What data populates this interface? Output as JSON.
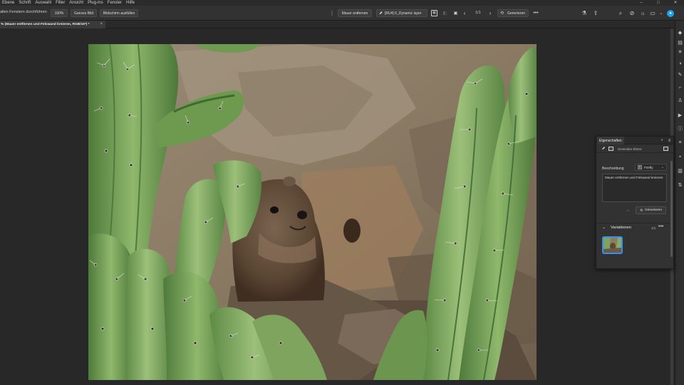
{
  "menu": {
    "items": [
      "Ebene",
      "Schrift",
      "Auswahl",
      "Filter",
      "Ansicht",
      "Plug-ins",
      "Fenster",
      "Hilfe"
    ],
    "window_controls": [
      "–",
      "□",
      "✕"
    ]
  },
  "options_bar": {
    "scroll_all_label": "allen Fenstern durchführen",
    "zoom_value": "100%",
    "fit_screen_label": "Ganzes Bild",
    "fill_screen_label": "Bildschirm ausfüllen",
    "remove_wall_label": "Mauer entfernen",
    "layer_name": "[RU4] 6_Dynamic layer",
    "page_counter": "1/1",
    "generate_label": "Generieren"
  },
  "document": {
    "tab_title": "% (Mauer entfernen und Felswand kreieren, RGB/16*) *",
    "close_glyph": "×"
  },
  "properties_panel": {
    "tab_label": "Eigenschaften",
    "layer_type": "Generative Ebene",
    "description_label": "Beschreibung",
    "model": "Firefly",
    "prompt": "Mauer entfernen und Felswand kreieren",
    "generate_label": "Generieren",
    "variations_title": "Variationen",
    "variations_count": "1/1",
    "more_glyph": "•••",
    "collapse_glyph": "⌄"
  },
  "right_toolbar": {
    "icons": [
      "layers-icon",
      "channels-icon",
      "adjustments-icon",
      "color-icon",
      "brush-settings-icon",
      "paths-icon",
      "people-icon",
      "history-icon",
      "info-icon",
      "shapes-icon",
      "swatches-icon",
      "gradient-icon",
      "properties-icon"
    ]
  },
  "colors": {
    "accent": "#3b8cf0",
    "app_bg": "#262626",
    "panel_bg": "#323232"
  }
}
